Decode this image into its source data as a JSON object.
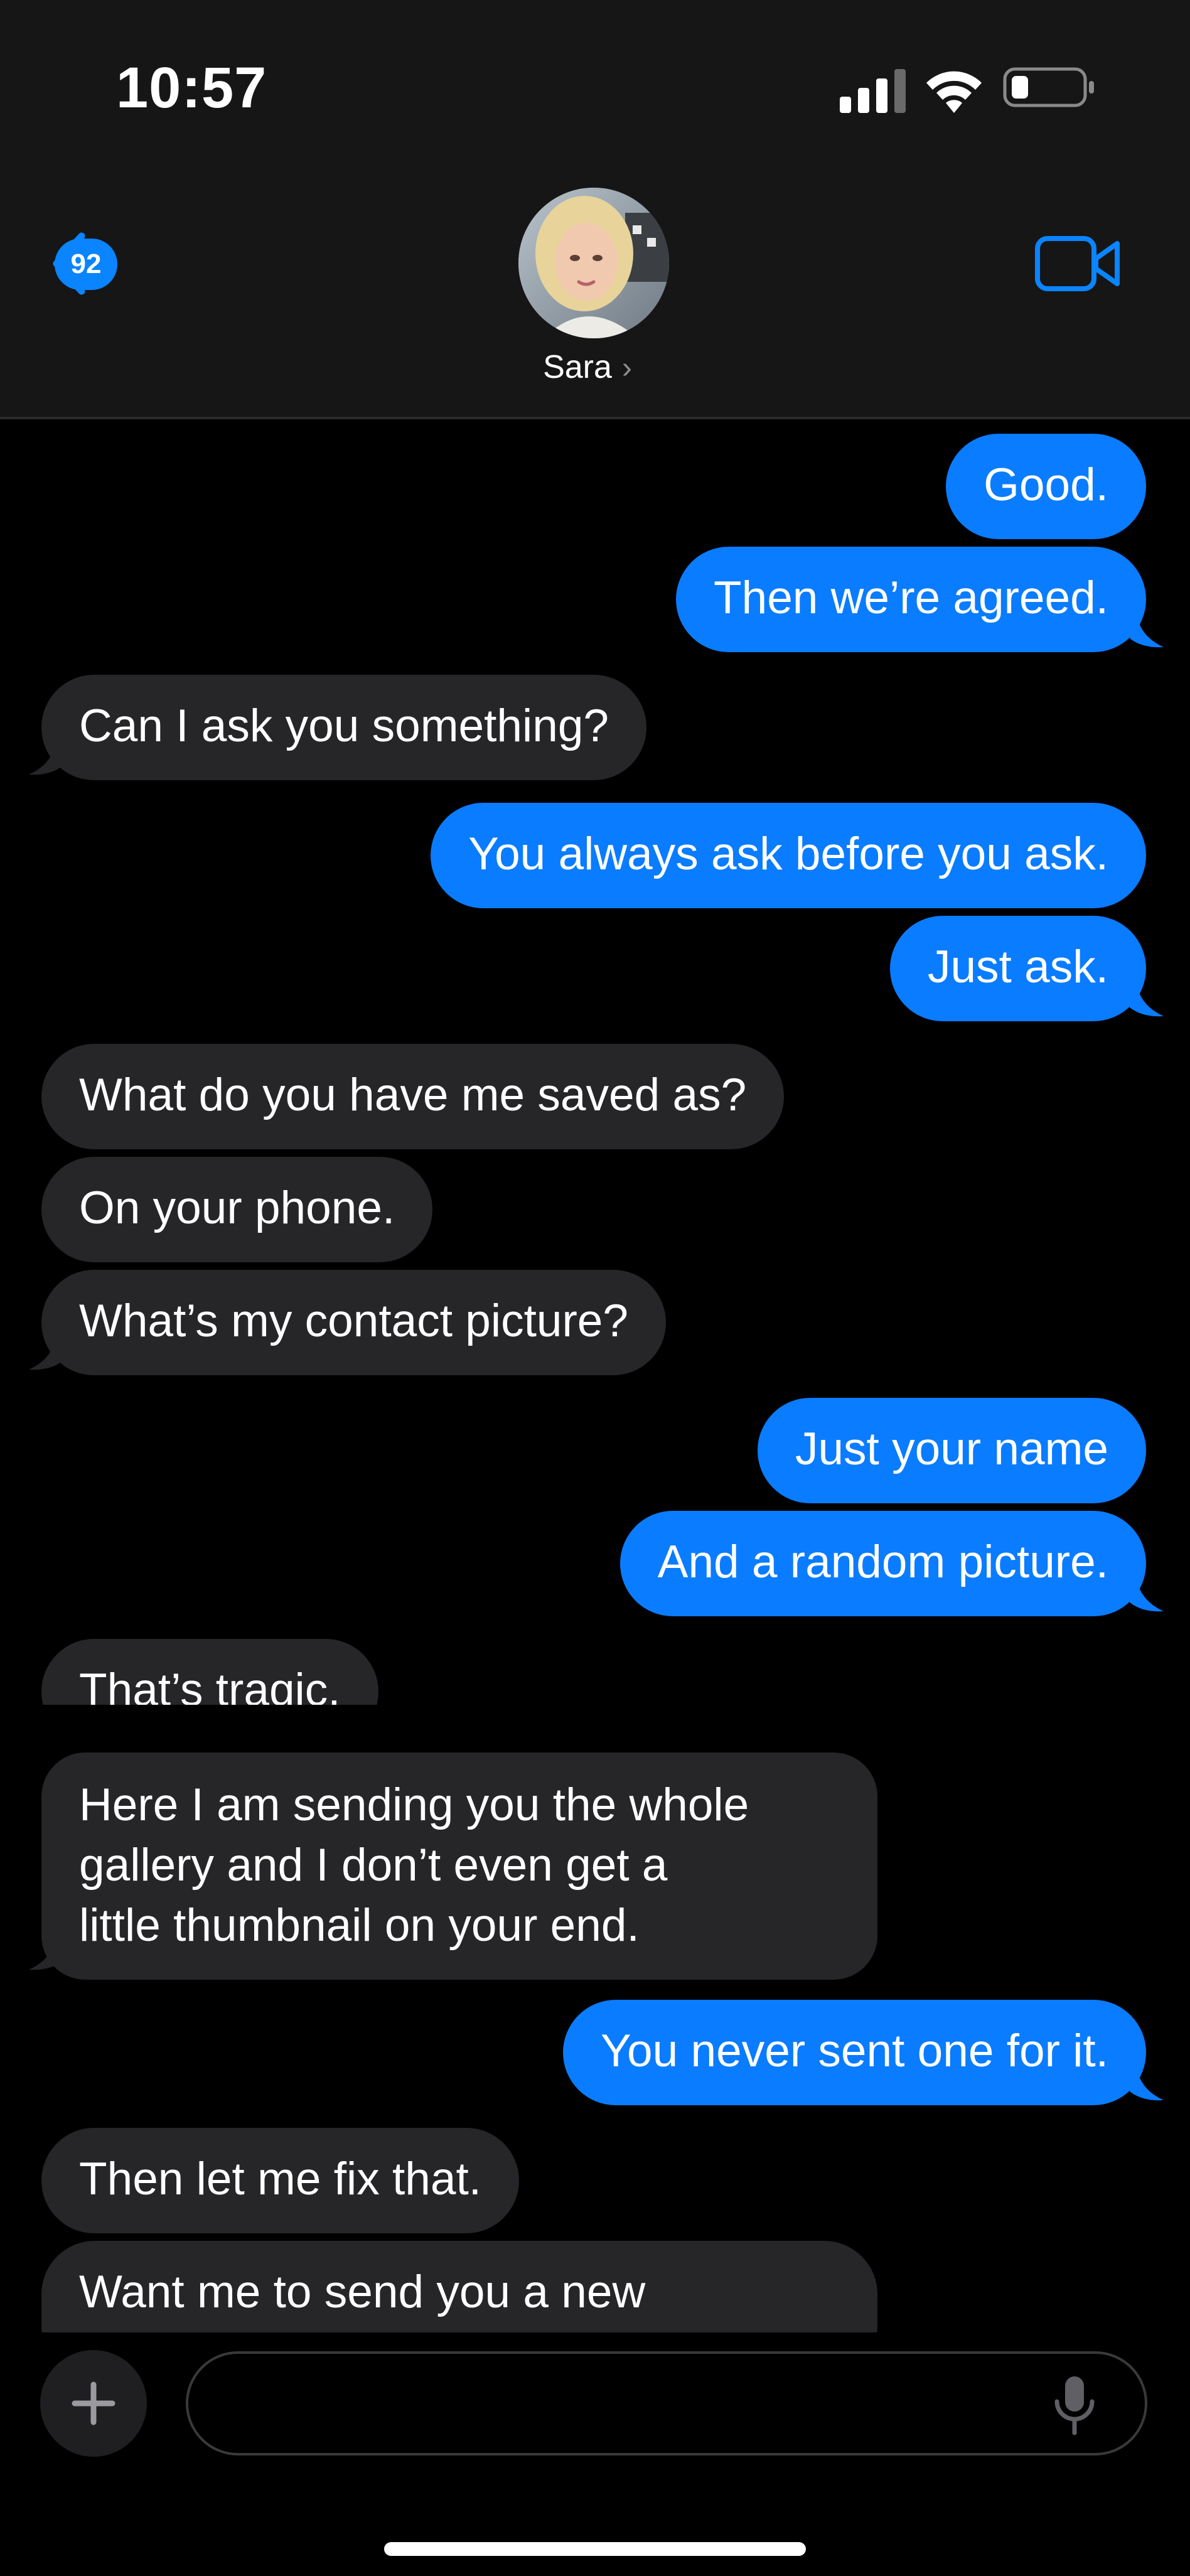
{
  "status_bar": {
    "time": "10:57"
  },
  "header": {
    "back_badge_count": "92",
    "contact_name": "Sara",
    "contact_chevron": "›",
    "icons": {
      "back": "chevron-left-icon",
      "video": "video-camera-icon"
    }
  },
  "messages": [
    {
      "dir": "out",
      "text": "Good."
    },
    {
      "dir": "out",
      "text": "Then we’re agreed."
    },
    {
      "dir": "in",
      "text": "Can I ask you something?"
    },
    {
      "dir": "out",
      "text": "You always ask before you ask."
    },
    {
      "dir": "out",
      "text": "Just ask."
    },
    {
      "dir": "in",
      "text": "What do you have me saved as?"
    },
    {
      "dir": "in",
      "text": "On your phone."
    },
    {
      "dir": "in",
      "text": "What’s my contact picture?"
    },
    {
      "dir": "out",
      "text": "Just your name"
    },
    {
      "dir": "out",
      "text": "And a random picture."
    },
    {
      "dir": "in",
      "text": "That’s tragic."
    },
    {
      "dir": "in",
      "lines": [
        "Here I am sending you the whole",
        "gallery and I don’t even get a",
        "little thumbnail on your end."
      ]
    },
    {
      "dir": "out",
      "text": "You never sent one for it."
    },
    {
      "dir": "in",
      "text": "Then let me fix that."
    },
    {
      "dir": "in",
      "text": "Want me to send you a new"
    }
  ],
  "composer": {
    "placeholder": "",
    "icons": {
      "add": "plus-icon",
      "mic": "microphone-icon"
    }
  },
  "colors": {
    "outgoing": "#0a7cff",
    "incoming": "#262629",
    "accent": "#0a84ff",
    "header": "#161616"
  }
}
